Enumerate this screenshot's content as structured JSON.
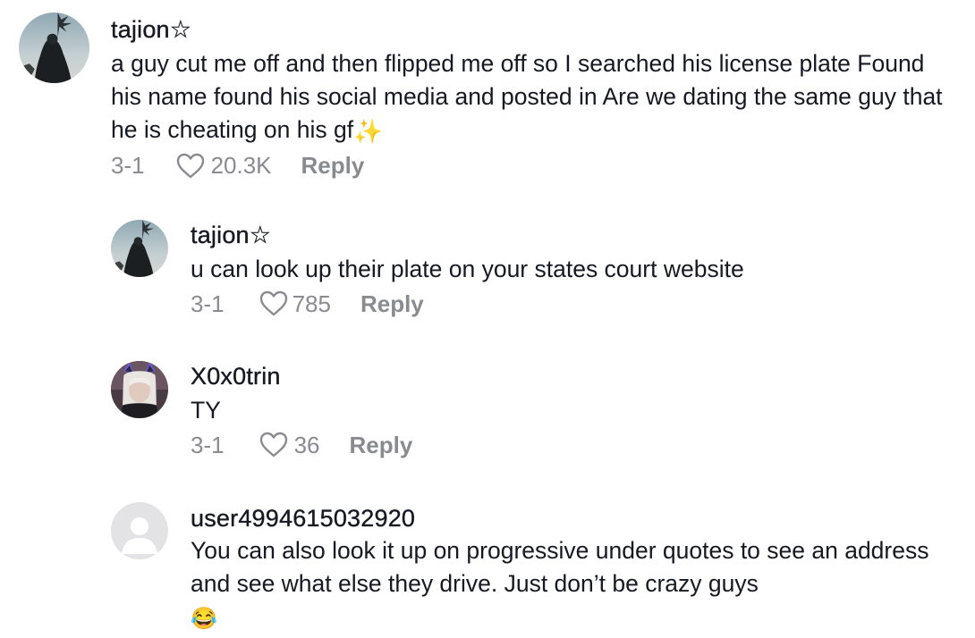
{
  "comments": [
    {
      "username": "tajion",
      "username_badge": "☆",
      "text": "a guy cut me off and then flipped me off so I searched his license plate Found his name found his social media and posted in Are we dating the same guy that he is cheating on his gf",
      "text_emoji": "✨",
      "date": "3-1",
      "likes": "20.3K",
      "reply_label": "Reply",
      "avatar": "profile-photo-palm-trees"
    },
    {
      "username": "tajion",
      "username_badge": "☆",
      "text": "u can look up their plate on your states court website",
      "date": "3-1",
      "likes": "785",
      "reply_label": "Reply",
      "avatar": "profile-photo-palm-trees"
    },
    {
      "username": "X0x0trin",
      "text": "TY",
      "date": "3-1",
      "likes": "36",
      "reply_label": "Reply",
      "avatar": "profile-photo-cat-ears-headset"
    },
    {
      "username": "user4994615032920",
      "text": "You can also look it up on progressive under quotes to see an address and see what else they drive. Just don’t be crazy guys",
      "text_emoji": "😂",
      "avatar": "default-avatar-icon"
    }
  ],
  "colors": {
    "text": "#161823",
    "secondary": "#8a8b91",
    "avatar_default_bg": "#e3e3e6"
  }
}
